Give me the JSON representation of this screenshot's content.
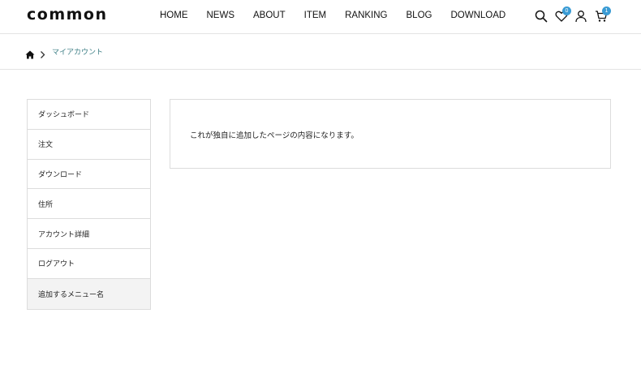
{
  "header": {
    "logo": "common",
    "nav": [
      "HOME",
      "NEWS",
      "ABOUT",
      "ITEM",
      "RANKING",
      "BLOG",
      "DOWNLOAD"
    ],
    "icons": {
      "search": "search-icon",
      "wishlist": "heart-icon",
      "account": "user-icon",
      "cart": "cart-icon"
    },
    "wishlist_count": "0",
    "cart_count": "1"
  },
  "breadcrumb": {
    "home_icon": "home-icon",
    "current": "マイアカウント"
  },
  "sidebar": {
    "items": [
      "ダッシュボード",
      "注文",
      "ダウンロード",
      "住所",
      "アカウント詳細",
      "ログアウト",
      "追加するメニュー名"
    ]
  },
  "content": {
    "text": "これが独自に追加したページの内容になります。"
  },
  "colors": {
    "badge": "#3a9bd4",
    "breadcrumb_link": "#3e7f86",
    "active_menu_bg": "#f3f3f3",
    "border": "#dcdcdc"
  }
}
